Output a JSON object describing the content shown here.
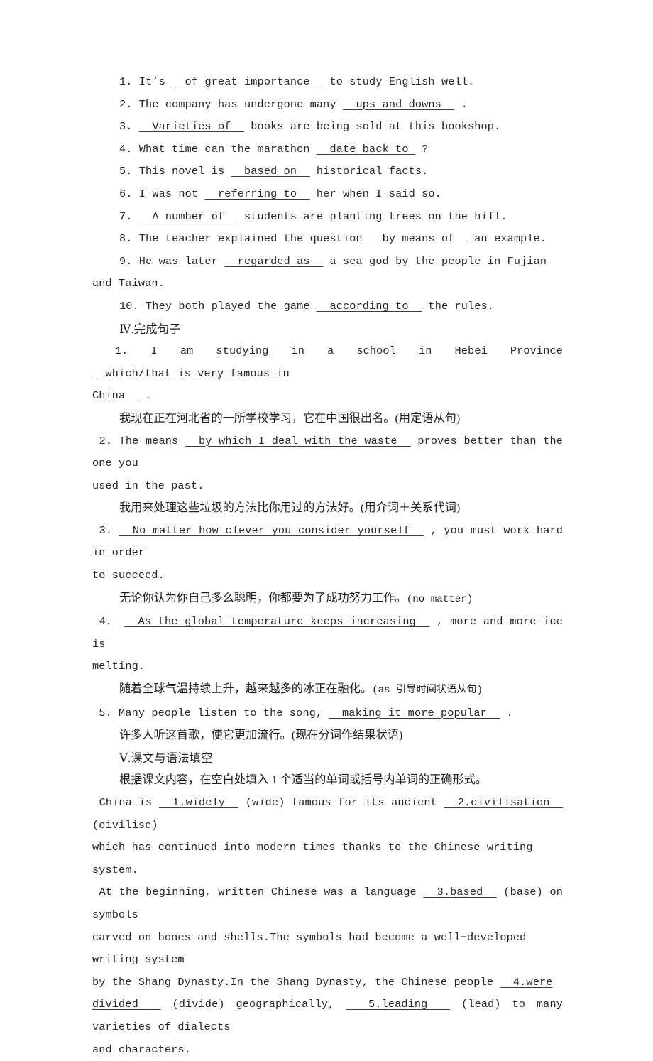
{
  "document": {
    "language_mix": "english-chinese",
    "page_background": "#ffffff",
    "text_color": "#262626",
    "underline_color": "#3a3a3a"
  },
  "exercise_three": {
    "items": [
      {
        "number": "1.",
        "before": " It’s ",
        "answer": "  of great importance  ",
        "after": " to study English well."
      },
      {
        "number": "2.",
        "before": " The company has undergone many ",
        "answer": "  ups and downs  ",
        "after": " ."
      },
      {
        "number": "3.",
        "before": " ",
        "answer": "  Varieties of  ",
        "after": " books are being sold at this bookshop."
      },
      {
        "number": "4.",
        "before": " What time can the marathon ",
        "answer": "  date back to ",
        "after": " ?"
      },
      {
        "number": "5.",
        "before": " This novel is ",
        "answer": "  based on  ",
        "after": " historical facts."
      },
      {
        "number": "6.",
        "before": " I was not ",
        "answer": "  referring to  ",
        "after": " her when I said so."
      },
      {
        "number": "7.",
        "before": " ",
        "answer": "  A number of  ",
        "after": " students are planting trees on the hill."
      },
      {
        "number": "8.",
        "before": " The teacher explained the question ",
        "answer": "  by means of  ",
        "after": " an example."
      },
      {
        "number": "9.",
        "before": " He was later ",
        "answer": "  regarded as  ",
        "after": " a sea god by the people in Fujian and Taiwan."
      },
      {
        "number": "10.",
        "before": " They both played the game ",
        "answer": "  according to  ",
        "after": " the rules."
      }
    ]
  },
  "section_four": {
    "heading": "Ⅳ.完成句子",
    "items": [
      {
        "number": "1.",
        "before": " I am studying in a school in Hebei Province ",
        "answer": "  which/that is very famous in China  ",
        "after": " .",
        "translation": "我现在正在河北省的一所学校学习，它在中国很出名。(用定语从句)",
        "line1": " 1. I am studying in a school in Hebei Province ",
        "answer_part1": "  which/that is very famous in",
        "line2_answer": "China  ",
        "line2_after": " ."
      },
      {
        "number": "2.",
        "line1_before": " 2. The means ",
        "answer": "  by which I deal with the waste  ",
        "line1_after": " proves better than the one you",
        "line2": "used in the past.",
        "translation": "我用来处理这些垃圾的方法比你用过的方法好。(用介词＋关系代词)"
      },
      {
        "number": "3.",
        "line1_before": " 3. ",
        "answer": "  No matter how clever you consider yourself  ",
        "line1_after": " , you must work hard in order",
        "line2": "to succeed.",
        "translation_zh": "无论你认为你自己多么聪明，你都要为了成功努力工作。",
        "translation_en": "(no matter)"
      },
      {
        "number": "4.",
        "line1_before": " 4． ",
        "answer": "  As the global temperature keeps increasing  ",
        "line1_after": " , more and more ice is",
        "line2": "melting.",
        "translation_zh": "随着全球气温持续上升，越来越多的冰正在融化。",
        "translation_en": "(as 引导时间状语从句)"
      },
      {
        "number": "5.",
        "line1_before": " 5. Many people listen to the song, ",
        "answer": "  making it more popular  ",
        "line1_after": " .",
        "translation": "许多人听这首歌，使它更加流行。(现在分词作结果状语)"
      }
    ]
  },
  "section_five": {
    "heading": "Ⅴ.课文与语法填空",
    "instruction": "根据课文内容，在空白处填入 1 个适当的单词或括号内单词的正确形式。",
    "paragraph_one": {
      "p1_before": " China is ",
      "blank1": "  1.widely  ",
      "p1_mid": " (wide) famous for its ancient ",
      "blank2": "  2.civilisation  ",
      "p1_after": " (civilise)",
      "line2": "which has continued into modern times thanks to the Chinese writing system."
    },
    "paragraph_two": {
      "l1_before": " At the beginning, written Chinese was a language ",
      "blank3": "  3.based  ",
      "l1_after": " (base) on symbols",
      "line2": "carved on bones and shells.The symbols had become a well−developed writing system",
      "l3_before": "by the Shang Dynasty.In the Shang Dynasty, the Chinese people ",
      "blank4_a": "  4.were",
      "blank4_b": "divided  ",
      "l4_mid": " (divide) geographically, ",
      "blank5": "  5.leading  ",
      "l4_after": " (lead) to many varieties of dialects",
      "line5": "and characters."
    }
  }
}
